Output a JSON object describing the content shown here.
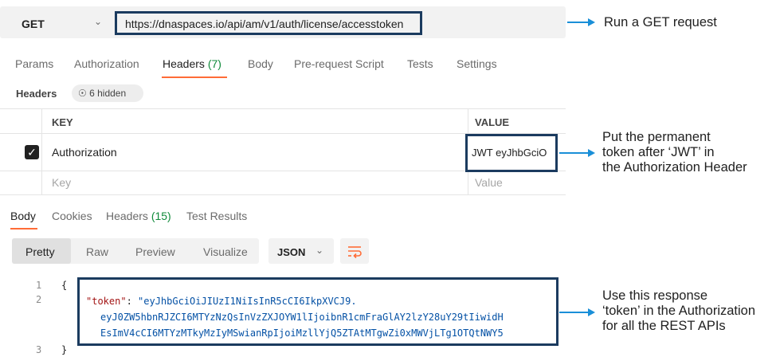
{
  "request": {
    "method": "GET",
    "url": "https://dnaspaces.io/api/am/v1/auth/license/accesstoken"
  },
  "tabs": [
    {
      "label": "Params"
    },
    {
      "label": "Authorization"
    },
    {
      "label": "Headers",
      "count": "(7)"
    },
    {
      "label": "Body"
    },
    {
      "label": "Pre-request Script"
    },
    {
      "label": "Tests"
    },
    {
      "label": "Settings"
    }
  ],
  "headers_section": {
    "label": "Headers",
    "hidden_pill": "6 hidden"
  },
  "table": {
    "col_key": "KEY",
    "col_value": "VALUE",
    "rows": [
      {
        "key": "Authorization",
        "value": "JWT eyJhbGciO",
        "checked": true
      }
    ],
    "placeholder_key": "Key",
    "placeholder_value": "Value"
  },
  "response_tabs": [
    {
      "label": "Body"
    },
    {
      "label": "Cookies"
    },
    {
      "label": "Headers",
      "count": "(15)"
    },
    {
      "label": "Test Results"
    }
  ],
  "view_modes": [
    "Pretty",
    "Raw",
    "Preview",
    "Visualize"
  ],
  "format": "JSON",
  "code": {
    "line_numbers": [
      "1",
      "2",
      "3"
    ],
    "open_brace": "{",
    "close_brace": "}",
    "key": "\"token\"",
    "colon": ": ",
    "line_a": "\"eyJhbGciOiJIUzI1NiIsInR5cCI6IkpXVCJ9.",
    "line_b": "eyJ0ZW5hbnRJZCI6MTYzNzQsInVzZXJOYW1lIjoibnR1cmFraGlAY2lzY28uY29tIiwidH",
    "line_c": "EsImV4cCI6MTYzMTkyMzIyMSwianRpIjoiMzllYjQ5ZTAtMTgwZi0xMWVjLTg1OTQtNWY5"
  },
  "annotations": {
    "run": "Run a GET request",
    "token": [
      "Put the permanent",
      "token after ‘JWT’ in",
      "the Authorization Header"
    ],
    "response": [
      "Use this response",
      "‘token’ in the Authorization",
      "for all the REST APIs"
    ]
  },
  "colors": {
    "highlight_box": "#1b3b5f",
    "accent_tab": "#ff6c37",
    "count_green": "#0f8a3a",
    "arrow": "#1a8fd8"
  }
}
